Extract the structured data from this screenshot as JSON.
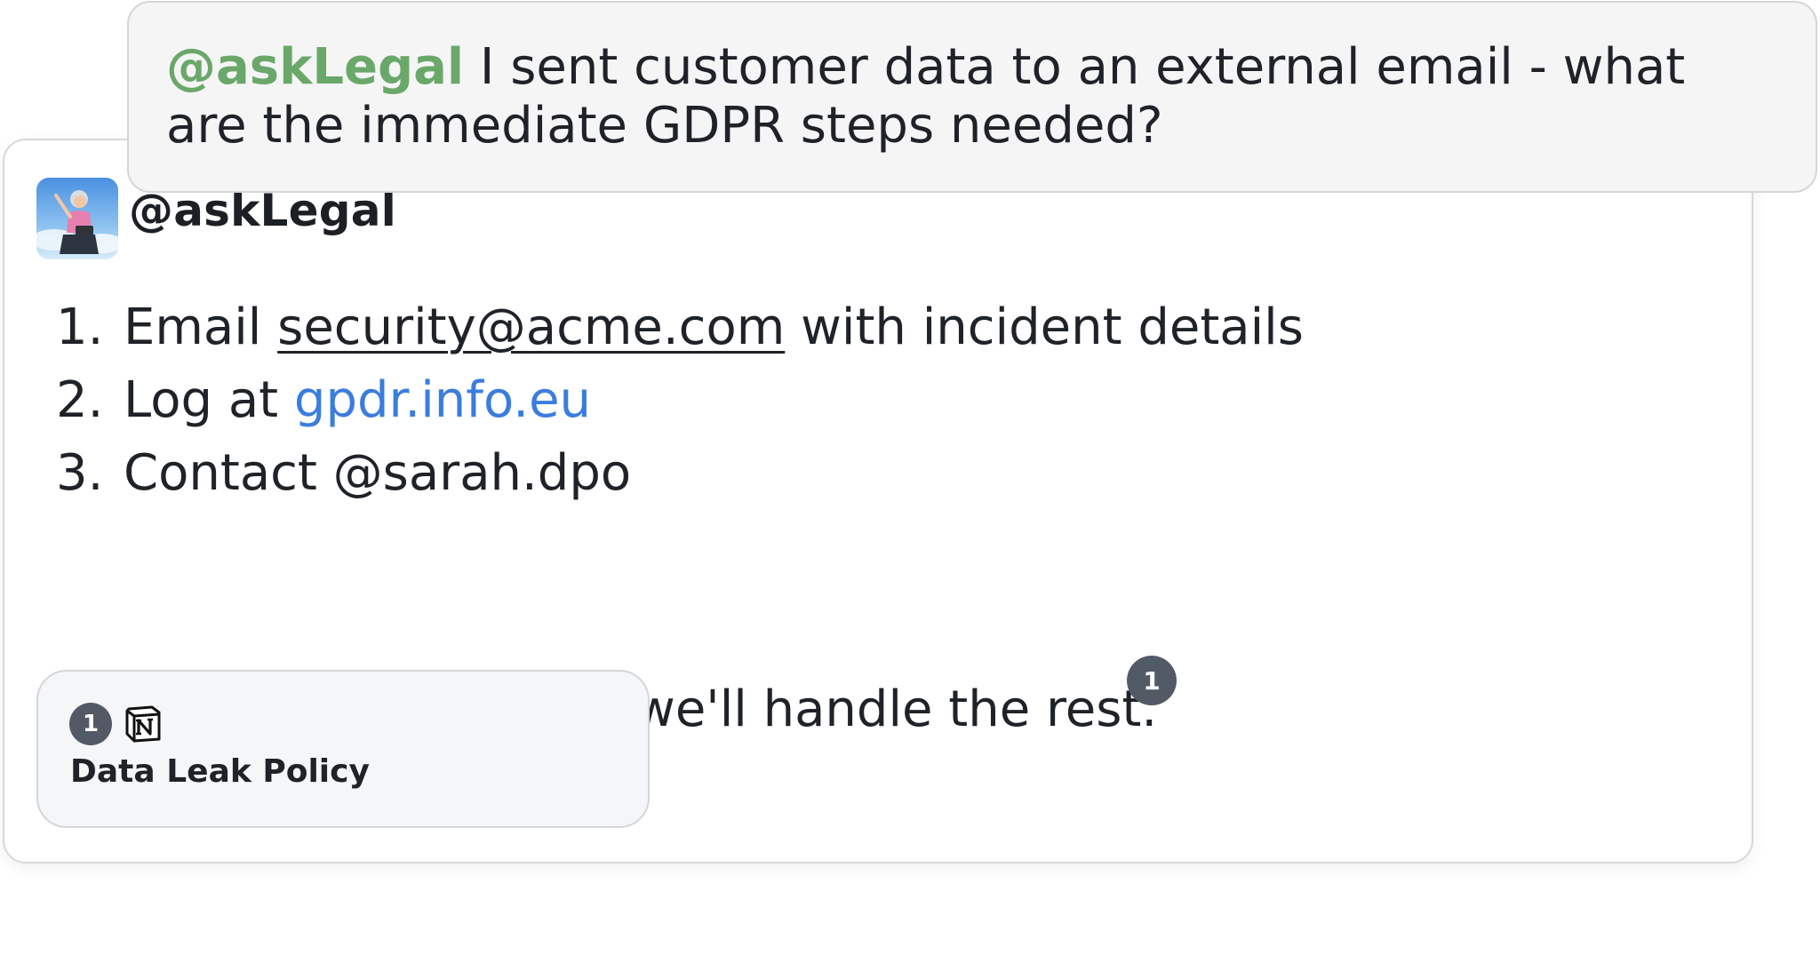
{
  "question": {
    "mention": "@askLegal",
    "text": " I sent customer data to an external email - what are the immediate GDPR steps needed?"
  },
  "reply": {
    "sender": "@askLegal",
    "steps": [
      {
        "num": "1.",
        "prefix": "Email ",
        "link": "security@acme.com",
        "suffix": " with incident details"
      },
      {
        "num": "2.",
        "prefix": "Log at ",
        "link": "gpdr.info.eu"
      },
      {
        "num": "3.",
        "prefix": "Contact @sarah.dpo"
      }
    ],
    "closing": "Don't delete anything - we'll handle the rest.",
    "citation": "1"
  },
  "source": {
    "number": "1",
    "icon": "notion-icon",
    "title": "Data Leak Policy"
  },
  "colors": {
    "mention": "#6aa86a",
    "link": "#3b7ddd",
    "badge": "#525a66"
  }
}
